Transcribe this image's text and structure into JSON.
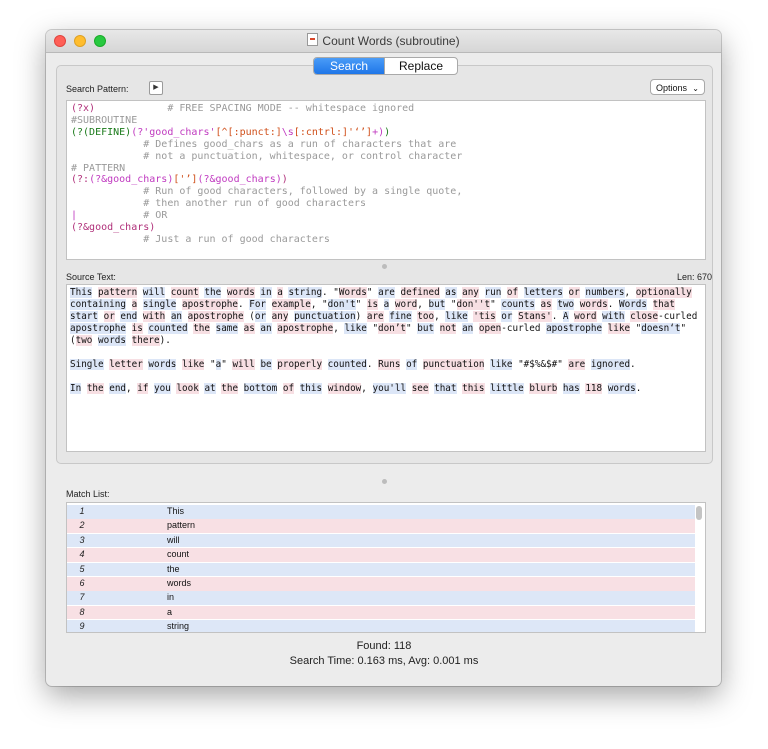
{
  "window": {
    "title": "Count Words (subroutine)"
  },
  "tabs": {
    "search": "Search",
    "replace": "Replace"
  },
  "search_pattern_label": "Search Pattern:",
  "options_label": "Options",
  "pattern_lines": [
    [
      {
        "t": "(?x)",
        "c": "#b0307a"
      },
      {
        "t": "            # FREE SPACING MODE -- whitespace ignored",
        "c": "#9a9a9a"
      }
    ],
    [
      {
        "t": "#SUBROUTINE",
        "c": "#9a9a9a"
      }
    ],
    [
      {
        "t": "(?(DEFINE)",
        "c": "#1a7a1a"
      },
      {
        "t": "(?'good_chars'",
        "c": "#c03ac0"
      },
      {
        "t": "[^[:punct:]",
        "c": "#d0501b"
      },
      {
        "t": "\\s",
        "c": "#c03ac0"
      },
      {
        "t": "[:cntrl:]'‘’]",
        "c": "#d0501b"
      },
      {
        "t": "+",
        "c": "#c03ac0"
      },
      {
        "t": ")",
        "c": "#c03ac0"
      },
      {
        "t": ")",
        "c": "#1a7a1a"
      }
    ],
    [
      {
        "t": "            # Defines good_chars as a run of characters that are",
        "c": "#9a9a9a"
      }
    ],
    [
      {
        "t": "            # not a punctuation, whitespace, or control character",
        "c": "#9a9a9a"
      }
    ],
    [
      {
        "t": "# PATTERN",
        "c": "#9a9a9a"
      }
    ],
    [
      {
        "t": "(?:",
        "c": "#b0307a"
      },
      {
        "t": "(?&good_chars)",
        "c": "#c03ac0"
      },
      {
        "t": "['’]",
        "c": "#d0501b"
      },
      {
        "t": "(?&good_chars)",
        "c": "#c03ac0"
      },
      {
        "t": ")",
        "c": "#b0307a"
      }
    ],
    [
      {
        "t": "            # Run of good characters, followed by a single quote,",
        "c": "#9a9a9a"
      }
    ],
    [
      {
        "t": "            # then another run of good characters",
        "c": "#9a9a9a"
      }
    ],
    [
      {
        "t": "|",
        "c": "#c03ac0"
      },
      {
        "t": "           # OR",
        "c": "#9a9a9a"
      }
    ],
    [
      {
        "t": "(?&good_chars)",
        "c": "#b0307a"
      }
    ],
    [
      {
        "t": "            # Just a run of good characters",
        "c": "#9a9a9a"
      }
    ]
  ],
  "source_text_label": "Source Text:",
  "len_label": "Len: 670",
  "source_paragraphs": [
    "This pattern will count the words in a string. \"Words\" are defined as any run of letters or numbers, optionally containing a single apostrophe. For example, \"don't\" is a word, but \"don''t\" counts as two words. Words that start or end with an apostrophe (or any punctuation) are fine too, like 'tis or Stans'. A word with close-curled apostrophe is counted the same as an apostrophe, like \"don’t\" but not an open-curled apostrophe like \"doesn‘t\" (two words there).",
    "Single letter words like \"a\" will be properly counted. Runs of punctuation like \"#$%&$#\" are ignored.",
    "In the end, if you look at the bottom of this window, you'll see that this little blurb has 118 words."
  ],
  "match_list_label": "Match List:",
  "matches": [
    {
      "index": "1",
      "value": "This"
    },
    {
      "index": "2",
      "value": "pattern"
    },
    {
      "index": "3",
      "value": "will"
    },
    {
      "index": "4",
      "value": "count"
    },
    {
      "index": "5",
      "value": "the"
    },
    {
      "index": "6",
      "value": "words"
    },
    {
      "index": "7",
      "value": "in"
    },
    {
      "index": "8",
      "value": "a"
    },
    {
      "index": "9",
      "value": "string"
    }
  ],
  "found": "Found: 118",
  "search_time": "Search Time: 0.163 ms, Avg: 0.001 ms"
}
